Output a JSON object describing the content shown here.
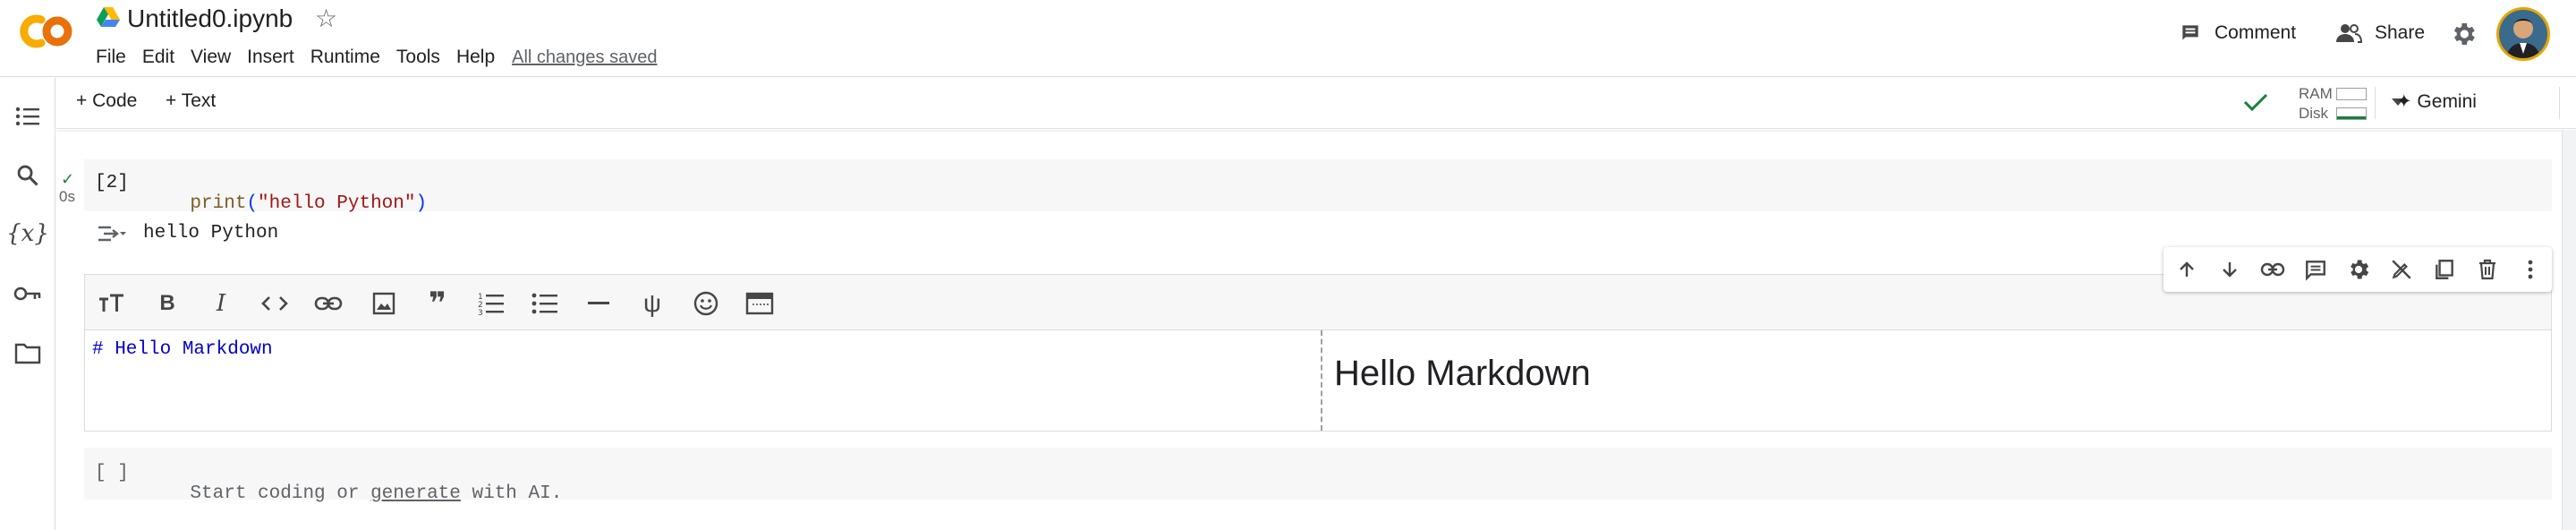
{
  "header": {
    "doc_title": "Untitled0.ipynb",
    "menu": [
      "File",
      "Edit",
      "View",
      "Insert",
      "Runtime",
      "Tools",
      "Help"
    ],
    "save_status": "All changes saved",
    "comment_label": "Comment",
    "share_label": "Share"
  },
  "toolbar": {
    "add_code_label": "+ Code",
    "add_text_label": "+ Text",
    "ram_label": "RAM",
    "disk_label": "Disk",
    "gemini_label": "✦ Gemini"
  },
  "left_rail": {
    "items": [
      "table-of-contents-icon",
      "search-icon",
      "variables-icon",
      "key-icon",
      "folder-icon"
    ],
    "variables_glyph": "{x}"
  },
  "cells": {
    "code1": {
      "exec_count": "[2]",
      "exec_time": "0s",
      "code_func": "print",
      "code_open": "(",
      "code_string": "\"hello Python\"",
      "code_close": ")",
      "output": "hello Python"
    },
    "markdown": {
      "source": "# Hello Markdown",
      "rendered_heading": "Hello Markdown"
    },
    "code2": {
      "exec_count": "[ ]",
      "placeholder_pre": "Start coding or ",
      "placeholder_link": "generate",
      "placeholder_post": " with AI."
    }
  },
  "colors": {
    "colab_orange": "#F9AB00",
    "string_red": "#A31515",
    "markdown_blue": "#0000CC",
    "check_green": "#188038"
  }
}
